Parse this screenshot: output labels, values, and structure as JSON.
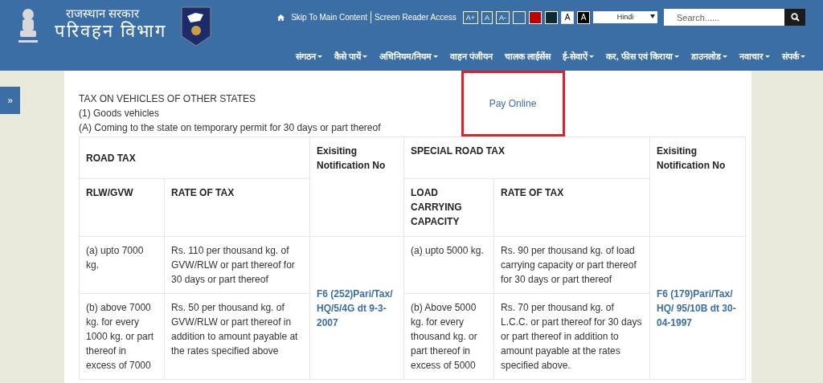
{
  "header": {
    "subtitle": "राजस्थान सरकार",
    "title": "परिवहन विभाग"
  },
  "utility": {
    "skip_link": "Skip To Main Content",
    "reader_link": "Screen Reader Access",
    "size_buttons": [
      "A+",
      "A",
      "A-"
    ],
    "themes": [
      {
        "color": "#3a6ea5"
      },
      {
        "color": "#c00000"
      },
      {
        "color": "#0d2a33"
      },
      {
        "label": "A",
        "color": "#ffffff"
      },
      {
        "label": "A",
        "color": "#000000"
      }
    ],
    "language": "Hindi",
    "search": {
      "placeholder": "Search......"
    }
  },
  "nav": [
    {
      "label": "संगठन",
      "dropdown": true
    },
    {
      "label": "कैसे पायें",
      "dropdown": true
    },
    {
      "label": "अधिनियम/नियम",
      "dropdown": true
    },
    {
      "label": "वाहन पंजीयन",
      "dropdown": false
    },
    {
      "label": "चालक लाईसेंस",
      "dropdown": false
    },
    {
      "label": "ई-सेवाऐं",
      "dropdown": true
    },
    {
      "label": "कर, फीस एवं किराया",
      "dropdown": true
    },
    {
      "label": "डाउनलोड",
      "dropdown": true
    },
    {
      "label": "नवाचार",
      "dropdown": true
    },
    {
      "label": "संपर्क",
      "dropdown": true
    }
  ],
  "sidebar_toggle": "»",
  "intro": [
    "TAX ON VEHICLES OF OTHER STATES",
    "(1)  Goods vehicles",
    "(A) Coming to the state on temporary permit for 30 days or part thereof"
  ],
  "pay_online": "Pay Online",
  "table": {
    "group_headers": [
      "ROAD TAX",
      "Exisiting Notification No",
      "SPECIAL ROAD TAX",
      "Exisiting Notification No"
    ],
    "sub_headers": [
      "RLW/GVW",
      "RATE OF TAX",
      "LOAD CARRYING CAPACITY",
      "RATE OF TAX"
    ],
    "rows": [
      {
        "weight": "(a) upto 7000 kg.",
        "rate": "Rs. 110 per thousand kg. of GVW/RLW or part thereof  for 30 days or part thereof",
        "capacity": "(a)  upto 5000 kg.",
        "special_rate": "Rs. 90 per thousand kg. of load carrying capacity or part thereof for 30 days or part thereof"
      },
      {
        "weight": "(b)  above 7000 kg. for every 1000 kg. or part thereof in excess of 7000",
        "rate": "Rs. 50 per thousand kg. of GVW/RLW or part thereof in addition to amount payable at the rates specified above",
        "capacity": "(b) Above 5000 kg. for every thousand kg. or part thereof in excess of 5000",
        "special_rate": "Rs. 70 per thousand kg. of L.C.C. or part thereof for 30 days or part thereof in addition to amount payable at the rates specified above."
      }
    ],
    "notifications": [
      "F6 (252)Pari/Tax/ HQ/5/4G dt 9-3-2007",
      "F6 (179)Pari/Tax/ HQ/ 95/10B dt 30-04-1997"
    ]
  }
}
